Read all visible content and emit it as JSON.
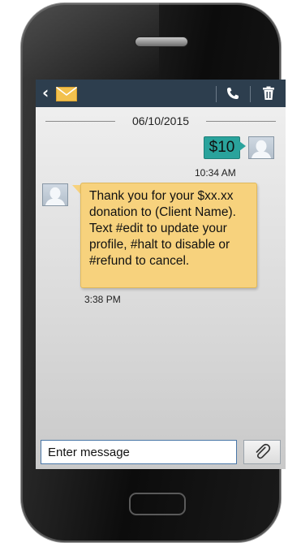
{
  "header": {
    "back_icon": "chevron-left-icon",
    "app_icon": "mail-envelope-icon",
    "call_icon": "phone-icon",
    "delete_icon": "trash-icon"
  },
  "thread": {
    "date": "06/10/2015",
    "messages": [
      {
        "direction": "outgoing",
        "text": "$10",
        "time": "10:34 AM"
      },
      {
        "direction": "incoming",
        "text": "Thank you for your $xx.xx donation to (Client Name). Text #edit to update your profile, #halt to disable or #refund to cancel.",
        "time": "3:38 PM"
      }
    ]
  },
  "composer": {
    "placeholder": "Enter message",
    "attach_icon": "paperclip-icon"
  },
  "colors": {
    "appbar": "#2d3e4e",
    "outgoing_bubble": "#2aa39c",
    "incoming_bubble": "#f7d27d",
    "envelope": "#f2c14e"
  }
}
